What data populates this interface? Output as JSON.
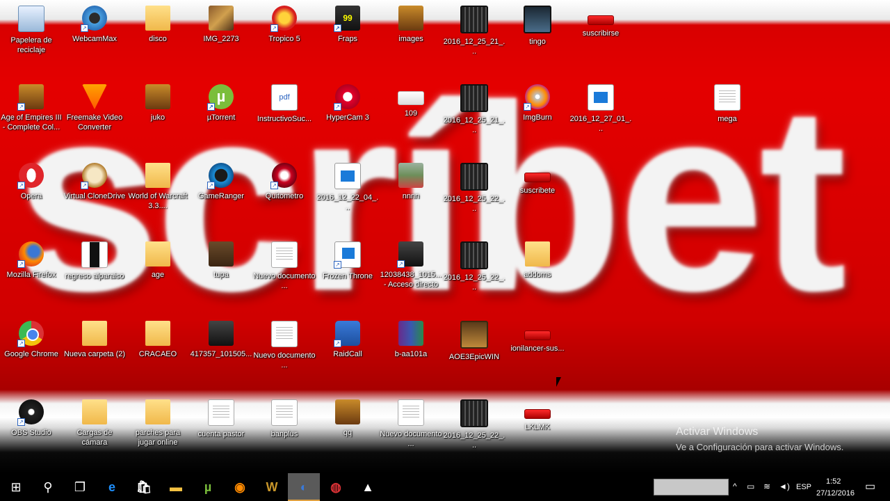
{
  "wallpaper": {
    "text": "scríbet"
  },
  "desktop_icons": [
    {
      "label": "Papelera de reciclaje",
      "icon": "recycle-bin-icon",
      "kind": "recycle",
      "shortcut": false
    },
    {
      "label": "WebcamMax",
      "icon": "webcam-icon",
      "kind": "webcam",
      "shortcut": true
    },
    {
      "label": "disco",
      "icon": "folder-icon",
      "kind": "folder",
      "shortcut": false
    },
    {
      "label": "IMG_2273",
      "icon": "photo-icon",
      "kind": "photo",
      "shortcut": false
    },
    {
      "label": "Tropico 5",
      "icon": "star-icon",
      "kind": "star",
      "shortcut": true
    },
    {
      "label": "Fraps",
      "icon": "fraps-icon",
      "kind": "fraps",
      "shortcut": true
    },
    {
      "label": "images",
      "icon": "folder-icon",
      "kind": "age",
      "shortcut": false
    },
    {
      "label": "2016_12_25_21_...",
      "icon": "video-file-icon",
      "kind": "film",
      "shortcut": false
    },
    {
      "label": "tingo",
      "icon": "video-file-icon",
      "kind": "film-dark",
      "shortcut": false
    },
    {
      "label": "suscribirse",
      "icon": "image-file-icon",
      "kind": "banner-red",
      "shortcut": false
    },
    {
      "label": "Age of Empires III - Complete Col...",
      "icon": "game-icon",
      "kind": "age",
      "shortcut": true
    },
    {
      "label": "Freemake Video Converter",
      "icon": "freemake-icon",
      "kind": "freemake",
      "shortcut": true
    },
    {
      "label": "juko",
      "icon": "folder-icon",
      "kind": "age",
      "shortcut": false
    },
    {
      "label": "µTorrent",
      "icon": "utorrent-icon",
      "kind": "utorrent",
      "shortcut": true
    },
    {
      "label": "InstructivoSuc...",
      "icon": "pdf-icon",
      "kind": "pdf",
      "shortcut": false
    },
    {
      "label": "HyperCam 3",
      "icon": "hypercam-icon",
      "kind": "hypercam",
      "shortcut": true
    },
    {
      "label": "109",
      "icon": "image-file-icon",
      "kind": "banner",
      "shortcut": false
    },
    {
      "label": "2016_12_25_21_...",
      "icon": "video-file-icon",
      "kind": "film",
      "shortcut": false
    },
    {
      "label": "ImgBurn",
      "icon": "imgburn-icon",
      "kind": "imgburn",
      "shortcut": true
    },
    {
      "label": "2016_12_27_01_...",
      "icon": "video-file-icon",
      "kind": "video",
      "shortcut": false
    },
    {
      "label": "mega",
      "icon": "document-icon",
      "kind": "doc",
      "shortcut": false
    },
    {
      "label": "Opera",
      "icon": "opera-icon",
      "kind": "opera",
      "shortcut": true
    },
    {
      "label": "Virtual CloneDrive",
      "icon": "clonedrive-icon",
      "kind": "clone",
      "shortcut": true
    },
    {
      "label": "World of Warcraft 3.3....",
      "icon": "folder-icon",
      "kind": "folder",
      "shortcut": false
    },
    {
      "label": "GameRanger",
      "icon": "gameranger-icon",
      "kind": "gameranger",
      "shortcut": true
    },
    {
      "label": "Quitometro",
      "icon": "quitometro-icon",
      "kind": "quito",
      "shortcut": true
    },
    {
      "label": "2016_12_22_04_...",
      "icon": "video-file-icon",
      "kind": "video",
      "shortcut": false
    },
    {
      "label": "nnnn",
      "icon": "image-file-icon",
      "kind": "grass",
      "shortcut": false
    },
    {
      "label": "2016_12_25_22_...",
      "icon": "video-file-icon",
      "kind": "film",
      "shortcut": false
    },
    {
      "label": "suscribete",
      "icon": "image-file-icon",
      "kind": "banner-red",
      "shortcut": false
    },
    {
      "label": "Mozilla Firefox",
      "icon": "firefox-icon",
      "kind": "firefox",
      "shortcut": true
    },
    {
      "label": "regreso alparaiso",
      "icon": "image-file-icon",
      "kind": "black",
      "shortcut": false
    },
    {
      "label": "age",
      "icon": "folder-icon",
      "kind": "folder",
      "shortcut": false
    },
    {
      "label": "tupa",
      "icon": "photo-icon",
      "kind": "tupa",
      "shortcut": false
    },
    {
      "label": "Nuevo documento ...",
      "icon": "document-icon",
      "kind": "doc",
      "shortcut": false
    },
    {
      "label": "Frozen Throne",
      "icon": "frozen-throne-icon",
      "kind": "frozen",
      "shortcut": true
    },
    {
      "label": "12038438_1015... - Acceso directo",
      "icon": "photo-icon",
      "kind": "portrait",
      "shortcut": true
    },
    {
      "label": "2016_12_25_22_...",
      "icon": "video-file-icon",
      "kind": "film",
      "shortcut": false
    },
    {
      "label": "addoms",
      "icon": "folder-icon",
      "kind": "folder",
      "shortcut": false
    },
    {
      "label": "Google Chrome",
      "icon": "chrome-icon",
      "kind": "chrome",
      "shortcut": true
    },
    {
      "label": "Nueva carpeta (2)",
      "icon": "folder-icon",
      "kind": "folder",
      "shortcut": false
    },
    {
      "label": "CRACAEO",
      "icon": "folder-icon",
      "kind": "folder",
      "shortcut": false
    },
    {
      "label": "417357_101505...",
      "icon": "photo-icon",
      "kind": "portrait",
      "shortcut": false
    },
    {
      "label": "Nuevo documento ...",
      "icon": "document-icon",
      "kind": "doc",
      "shortcut": false
    },
    {
      "label": "RaidCall",
      "icon": "raidcall-icon",
      "kind": "raidcall",
      "shortcut": true
    },
    {
      "label": "b-aa101a",
      "icon": "winrar-icon",
      "kind": "winrar",
      "shortcut": false
    },
    {
      "label": "AOE3EpicWIN",
      "icon": "video-file-icon",
      "kind": "aoe",
      "shortcut": false
    },
    {
      "label": "ionilancer-sus...",
      "icon": "image-file-icon",
      "kind": "banner-red",
      "shortcut": false
    },
    {
      "label": "OBS Studio",
      "icon": "obs-icon",
      "kind": "obs",
      "shortcut": true
    },
    {
      "label": "Cargas de cámara",
      "icon": "folder-icon",
      "kind": "folder",
      "shortcut": false
    },
    {
      "label": "parches para jugar online",
      "icon": "folder-icon",
      "kind": "folder",
      "shortcut": false
    },
    {
      "label": "cuenta pastor",
      "icon": "document-icon",
      "kind": "doc",
      "shortcut": false
    },
    {
      "label": "banplus",
      "icon": "document-icon",
      "kind": "doc",
      "shortcut": false
    },
    {
      "label": "qq",
      "icon": "image-file-icon",
      "kind": "age",
      "shortcut": false
    },
    {
      "label": "Nuevo documento ...",
      "icon": "document-icon",
      "kind": "doc",
      "shortcut": false
    },
    {
      "label": "2016_12_25_22_...",
      "icon": "video-file-icon",
      "kind": "film",
      "shortcut": false
    },
    {
      "label": "LKLMK",
      "icon": "image-file-icon",
      "kind": "banner-red",
      "shortcut": false
    }
  ],
  "watermark": {
    "title": "Activar Windows",
    "subtitle": "Ve a Configuración para activar Windows."
  },
  "taskbar": {
    "start_glyph": "⊞",
    "search_glyph": "⚲",
    "taskview_glyph": "❐",
    "apps": [
      {
        "icon": "edge-icon",
        "glyph": "e",
        "color": "#1e90ff"
      },
      {
        "icon": "store-icon",
        "glyph": "🛍",
        "color": "#ffffff"
      },
      {
        "icon": "file-explorer-icon",
        "glyph": "▬",
        "color": "#f5c242"
      },
      {
        "icon": "utorrent-icon",
        "glyph": "µ",
        "color": "#7bbe3b"
      },
      {
        "icon": "imgburn-icon",
        "glyph": "◉",
        "color": "#ff8a00"
      },
      {
        "icon": "warcraft-icon",
        "glyph": "W",
        "color": "#c8962a"
      },
      {
        "icon": "raidcall-icon",
        "glyph": "◐",
        "color": "#3a7ad9"
      },
      {
        "icon": "chrome-icon",
        "glyph": "◍",
        "color": "#db3236"
      },
      {
        "icon": "photos-icon",
        "glyph": "▲",
        "color": "#ffffff"
      }
    ],
    "tray": {
      "language": "ESP",
      "time": "1:52",
      "date": "27/12/2016",
      "notification_glyph": "▭"
    }
  },
  "colors": {
    "accent": "#e0a040",
    "wallpaper_red": "#d80000",
    "taskbar": "#000000"
  }
}
